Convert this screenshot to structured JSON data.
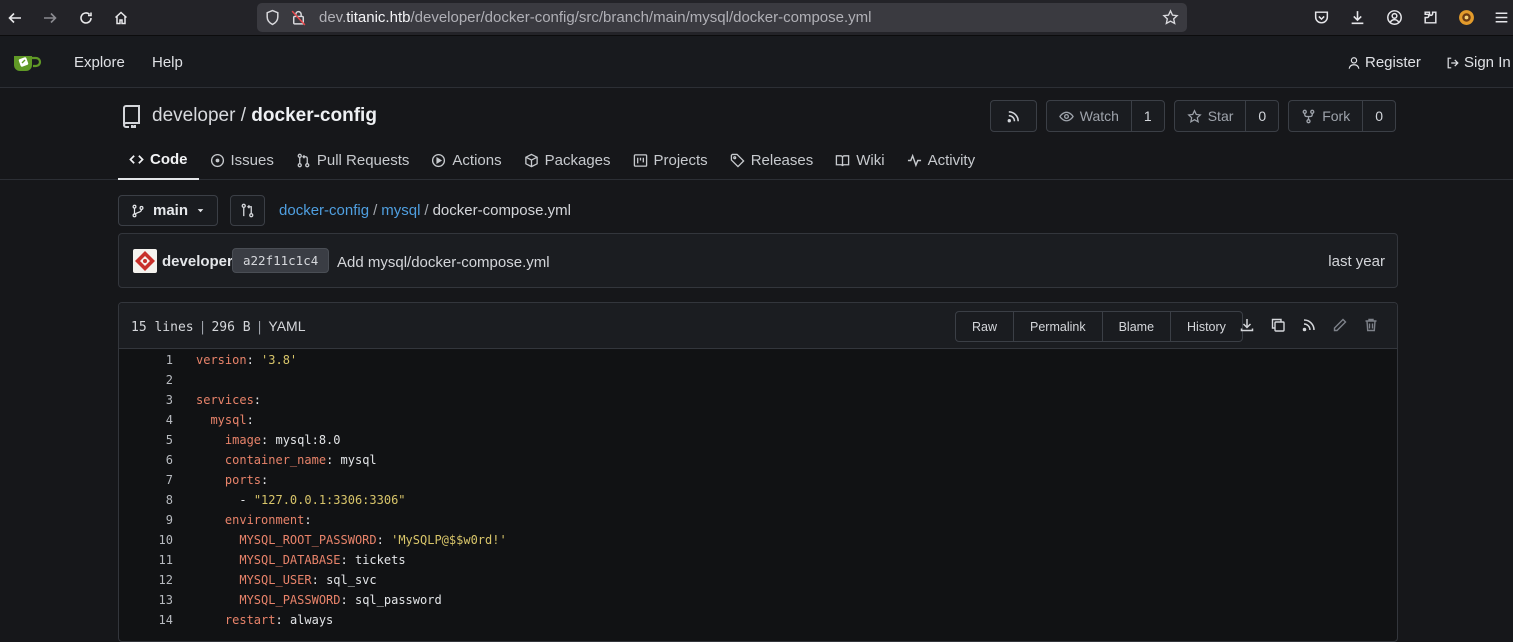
{
  "browser": {
    "url_prefix": "dev.",
    "url_host": "titanic.htb",
    "url_path": "/developer/docker-config/src/branch/main/mysql/docker-compose.yml"
  },
  "header": {
    "explore": "Explore",
    "help": "Help",
    "register": "Register",
    "sign_in": "Sign In"
  },
  "repo": {
    "owner": "developer",
    "separator": "/",
    "name": "docker-config",
    "watch_label": "Watch",
    "watch_count": "1",
    "star_label": "Star",
    "star_count": "0",
    "fork_label": "Fork",
    "fork_count": "0",
    "tabs": [
      {
        "label": "Code"
      },
      {
        "label": "Issues"
      },
      {
        "label": "Pull Requests"
      },
      {
        "label": "Actions"
      },
      {
        "label": "Packages"
      },
      {
        "label": "Projects"
      },
      {
        "label": "Releases"
      },
      {
        "label": "Wiki"
      },
      {
        "label": "Activity"
      }
    ]
  },
  "branch": {
    "name": "main",
    "crumbs": [
      "docker-config",
      "mysql"
    ],
    "crumb_sep": "/",
    "current_file": "docker-compose.yml"
  },
  "commit": {
    "author": "developer",
    "sha": "a22f11c1c4",
    "message": "Add mysql/docker-compose.yml",
    "time": "last year"
  },
  "file": {
    "lines_info": "15 lines",
    "size_info": "296 B",
    "language": "YAML",
    "actions": [
      "Raw",
      "Permalink",
      "Blame",
      "History"
    ]
  },
  "code_lines": [
    {
      "n": "1",
      "indent": "",
      "key": "version",
      "punct": ": ",
      "value": "'3.8'",
      "value_type": "str"
    },
    {
      "n": "2",
      "indent": "",
      "key": "",
      "punct": "",
      "value": "",
      "value_type": "plain"
    },
    {
      "n": "3",
      "indent": "",
      "key": "services",
      "punct": ":",
      "value": "",
      "value_type": "plain"
    },
    {
      "n": "4",
      "indent": "  ",
      "key": "mysql",
      "punct": ":",
      "value": "",
      "value_type": "plain"
    },
    {
      "n": "5",
      "indent": "    ",
      "key": "image",
      "punct": ": ",
      "value": "mysql:8.0",
      "value_type": "plain"
    },
    {
      "n": "6",
      "indent": "    ",
      "key": "container_name",
      "punct": ": ",
      "value": "mysql",
      "value_type": "plain"
    },
    {
      "n": "7",
      "indent": "    ",
      "key": "ports",
      "punct": ":",
      "value": "",
      "value_type": "plain"
    },
    {
      "n": "8",
      "indent": "      ",
      "key": "",
      "punct": "- ",
      "value": "\"127.0.0.1:3306:3306\"",
      "value_type": "str"
    },
    {
      "n": "9",
      "indent": "    ",
      "key": "environment",
      "punct": ":",
      "value": "",
      "value_type": "plain"
    },
    {
      "n": "10",
      "indent": "      ",
      "key": "MYSQL_ROOT_PASSWORD",
      "punct": ": ",
      "value": "'MySQLP@$$w0rd!'",
      "value_type": "str"
    },
    {
      "n": "11",
      "indent": "      ",
      "key": "MYSQL_DATABASE",
      "punct": ": ",
      "value": "tickets",
      "value_type": "plain"
    },
    {
      "n": "12",
      "indent": "      ",
      "key": "MYSQL_USER",
      "punct": ": ",
      "value": "sql_svc",
      "value_type": "plain"
    },
    {
      "n": "13",
      "indent": "      ",
      "key": "MYSQL_PASSWORD",
      "punct": ": ",
      "value": "sql_password",
      "value_type": "plain"
    },
    {
      "n": "14",
      "indent": "    ",
      "key": "restart",
      "punct": ": ",
      "value": "always",
      "value_type": "plain"
    }
  ]
}
